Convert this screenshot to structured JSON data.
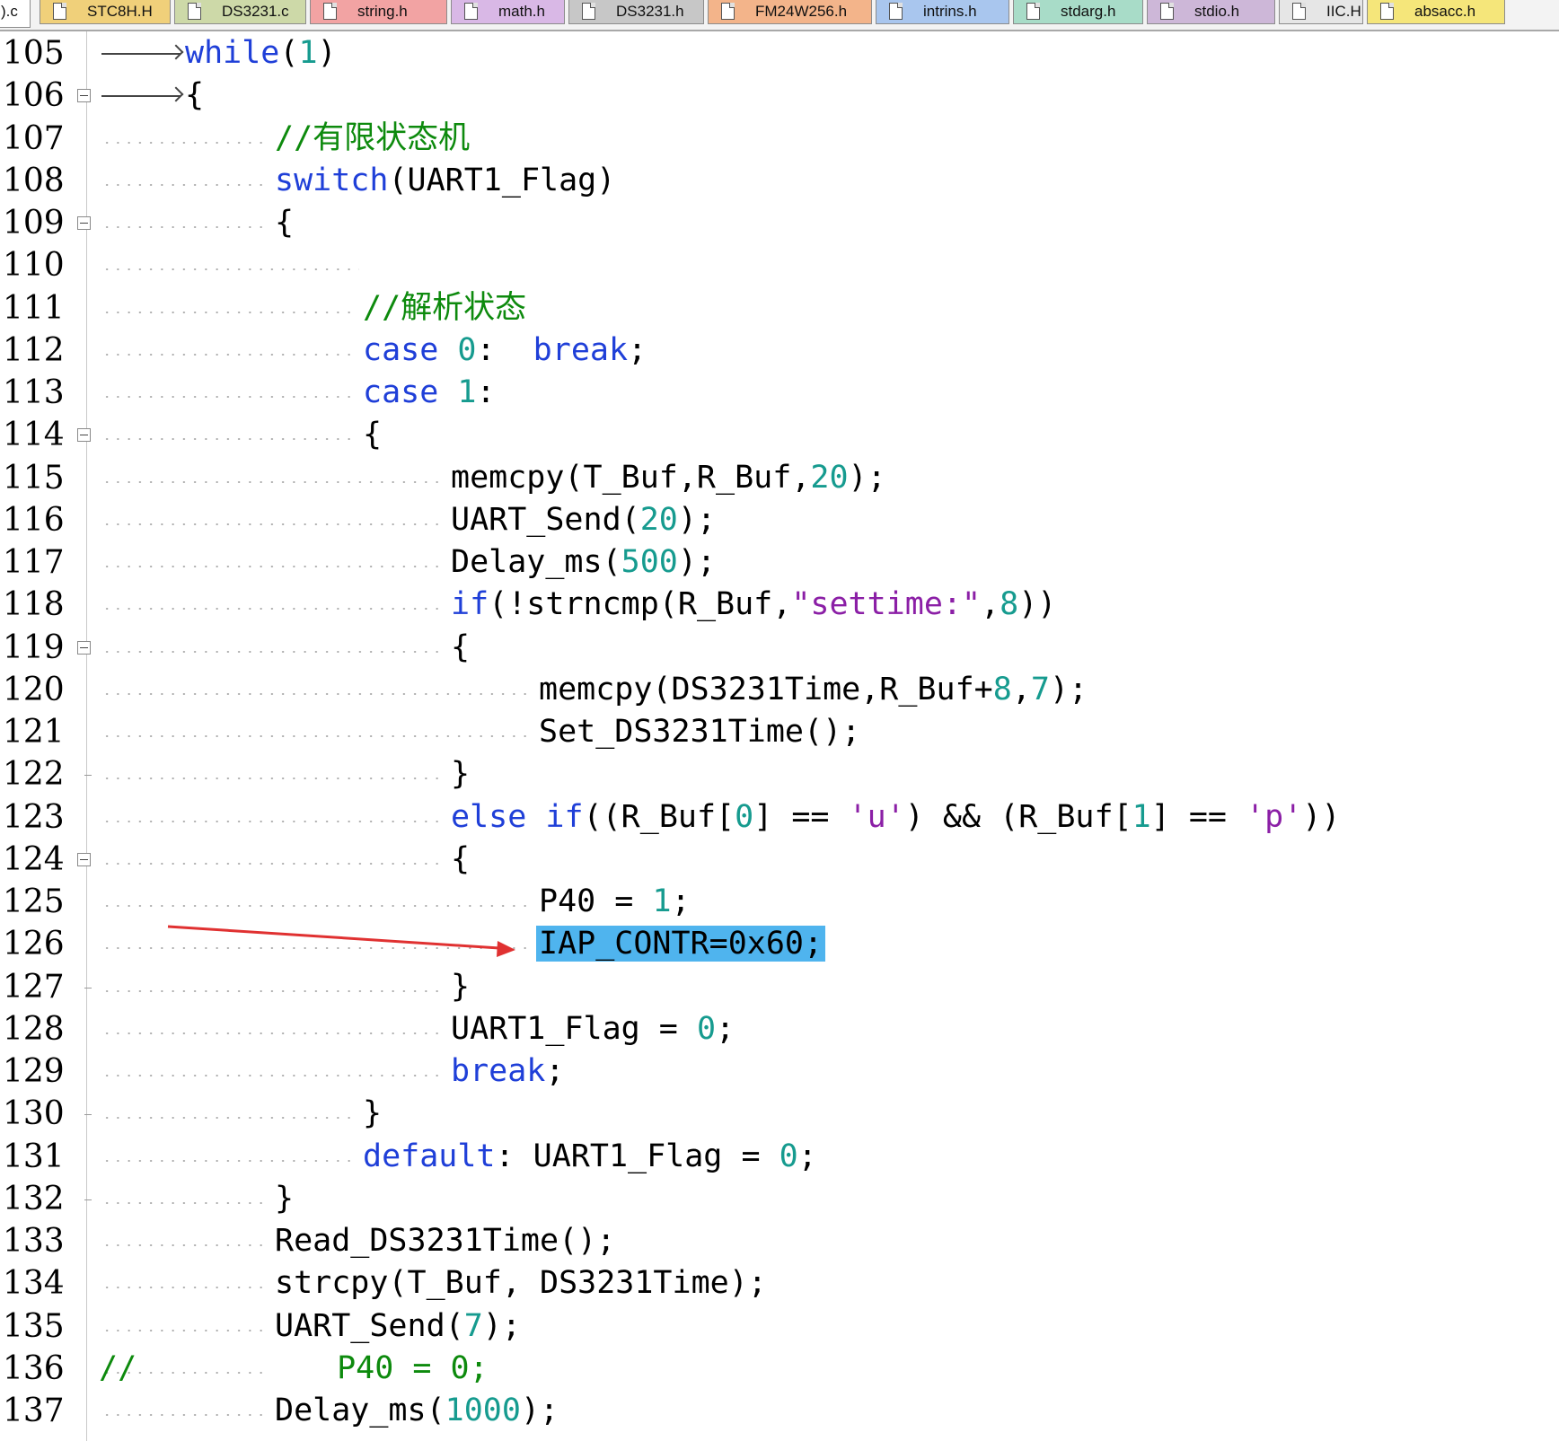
{
  "tabs": [
    {
      "label": ").c",
      "color": "#e8e8e8",
      "active": true
    },
    {
      "label": "STC8H.H",
      "color": "#f0d07a"
    },
    {
      "label": "DS3231.c",
      "color": "#cdd9a8"
    },
    {
      "label": "string.h",
      "color": "#f2a3a3"
    },
    {
      "label": "math.h",
      "color": "#d9b8e6"
    },
    {
      "label": "DS3231.h",
      "color": "#c7c7c7"
    },
    {
      "label": "FM24W256.h",
      "color": "#f3b48a"
    },
    {
      "label": "intrins.h",
      "color": "#a9c6ee"
    },
    {
      "label": "stdarg.h",
      "color": "#a8dcc8"
    },
    {
      "label": "stdio.h",
      "color": "#cdb7d8"
    },
    {
      "label": "IIC.H",
      "color": "#e6e6e6"
    },
    {
      "label": "absacc.h",
      "color": "#f5e67a"
    }
  ],
  "editor": {
    "annotation": "red-arrow pointing at highlighted line 126",
    "lines": [
      {
        "n": "105",
        "indent": 0,
        "tabArrow": true,
        "tokens": [
          [
            "kw",
            "while"
          ],
          [
            "p",
            "("
          ],
          [
            "num",
            "1"
          ],
          [
            "p",
            ")"
          ]
        ]
      },
      {
        "n": "106",
        "indent": 0,
        "tabArrow": true,
        "fold": "open",
        "tokens": [
          [
            "p",
            "{"
          ]
        ]
      },
      {
        "n": "107",
        "indent": 1,
        "tokens": [
          [
            "cmt",
            "//有限状态机"
          ]
        ]
      },
      {
        "n": "108",
        "indent": 1,
        "tokens": [
          [
            "kw",
            "switch"
          ],
          [
            "p",
            "(UART1_Flag)"
          ]
        ]
      },
      {
        "n": "109",
        "indent": 1,
        "fold": "open",
        "tokens": [
          [
            "p",
            "{"
          ]
        ]
      },
      {
        "n": "110",
        "indent": 1,
        "tokens": []
      },
      {
        "n": "111",
        "indent": 2,
        "tokens": [
          [
            "cmt",
            "//解析状态"
          ]
        ]
      },
      {
        "n": "112",
        "indent": 2,
        "tokens": [
          [
            "kw",
            "case"
          ],
          [
            "p",
            " "
          ],
          [
            "num",
            "0"
          ],
          [
            "p",
            ":  "
          ],
          [
            "kw",
            "break"
          ],
          [
            "p",
            ";"
          ]
        ]
      },
      {
        "n": "113",
        "indent": 2,
        "tokens": [
          [
            "kw",
            "case"
          ],
          [
            "p",
            " "
          ],
          [
            "num",
            "1"
          ],
          [
            "p",
            ":"
          ]
        ]
      },
      {
        "n": "114",
        "indent": 2,
        "fold": "open",
        "tokens": [
          [
            "p",
            "{"
          ]
        ]
      },
      {
        "n": "115",
        "indent": 3,
        "tokens": [
          [
            "p",
            "memcpy(T_Buf,R_Buf,"
          ],
          [
            "num",
            "20"
          ],
          [
            "p",
            ");"
          ]
        ]
      },
      {
        "n": "116",
        "indent": 3,
        "tokens": [
          [
            "p",
            "UART_Send("
          ],
          [
            "num",
            "20"
          ],
          [
            "p",
            ");"
          ]
        ]
      },
      {
        "n": "117",
        "indent": 3,
        "tokens": [
          [
            "p",
            "Delay_ms("
          ],
          [
            "num",
            "500"
          ],
          [
            "p",
            ");"
          ]
        ]
      },
      {
        "n": "118",
        "indent": 3,
        "tokens": [
          [
            "kw",
            "if"
          ],
          [
            "p",
            "(!strncmp(R_Buf,"
          ],
          [
            "str",
            "\"settime:\""
          ],
          [
            "p",
            ","
          ],
          [
            "num",
            "8"
          ],
          [
            "p",
            "))"
          ]
        ]
      },
      {
        "n": "119",
        "indent": 3,
        "fold": "open",
        "tokens": [
          [
            "p",
            "{"
          ]
        ]
      },
      {
        "n": "120",
        "indent": 4,
        "tokens": [
          [
            "p",
            "memcpy(DS3231Time,R_Buf+"
          ],
          [
            "num",
            "8"
          ],
          [
            "p",
            ","
          ],
          [
            "num",
            "7"
          ],
          [
            "p",
            ");"
          ]
        ]
      },
      {
        "n": "121",
        "indent": 4,
        "tokens": [
          [
            "p",
            "Set_DS3231Time();"
          ]
        ]
      },
      {
        "n": "122",
        "indent": 3,
        "foldEnd": true,
        "tokens": [
          [
            "p",
            "}"
          ]
        ]
      },
      {
        "n": "123",
        "indent": 3,
        "tokens": [
          [
            "kw",
            "else"
          ],
          [
            "p",
            " "
          ],
          [
            "kw",
            "if"
          ],
          [
            "p",
            "((R_Buf["
          ],
          [
            "num",
            "0"
          ],
          [
            "p",
            "] == "
          ],
          [
            "str",
            "'u'"
          ],
          [
            "p",
            ") && (R_Buf["
          ],
          [
            "num",
            "1"
          ],
          [
            "p",
            "] == "
          ],
          [
            "str",
            "'p'"
          ],
          [
            "p",
            "))"
          ]
        ]
      },
      {
        "n": "124",
        "indent": 3,
        "fold": "open",
        "tokens": [
          [
            "p",
            "{"
          ]
        ]
      },
      {
        "n": "125",
        "indent": 4,
        "tokens": [
          [
            "p",
            "P40 = "
          ],
          [
            "num",
            "1"
          ],
          [
            "p",
            ";"
          ]
        ]
      },
      {
        "n": "126",
        "indent": 4,
        "selected": true,
        "tokens": [
          [
            "sel",
            "IAP_CONTR=0x60;"
          ]
        ]
      },
      {
        "n": "127",
        "indent": 3,
        "foldEnd": true,
        "tokens": [
          [
            "p",
            "}"
          ]
        ]
      },
      {
        "n": "128",
        "indent": 3,
        "tokens": [
          [
            "p",
            "UART1_Flag = "
          ],
          [
            "num",
            "0"
          ],
          [
            "p",
            ";"
          ]
        ]
      },
      {
        "n": "129",
        "indent": 3,
        "tokens": [
          [
            "kw",
            "break"
          ],
          [
            "p",
            ";"
          ]
        ]
      },
      {
        "n": "130",
        "indent": 2,
        "foldEnd": true,
        "tokens": [
          [
            "p",
            "}"
          ]
        ]
      },
      {
        "n": "131",
        "indent": 2,
        "tokens": [
          [
            "kw",
            "default"
          ],
          [
            "p",
            ": UART1_Flag = "
          ],
          [
            "num",
            "0"
          ],
          [
            "p",
            ";"
          ]
        ]
      },
      {
        "n": "132",
        "indent": 1,
        "foldEnd": true,
        "tokens": [
          [
            "p",
            "}"
          ]
        ]
      },
      {
        "n": "133",
        "indent": 1,
        "tokens": [
          [
            "p",
            "Read_DS3231Time();"
          ]
        ]
      },
      {
        "n": "134",
        "indent": 1,
        "tokens": [
          [
            "p",
            "strcpy(T_Buf, DS3231Time);"
          ]
        ]
      },
      {
        "n": "135",
        "indent": 1,
        "tokens": [
          [
            "p",
            "UART_Send("
          ],
          [
            "num",
            "7"
          ],
          [
            "p",
            ");"
          ]
        ]
      },
      {
        "n": "136",
        "indent": 1,
        "commentPrefix": "//",
        "tokens": [
          [
            "cmt",
            " P40 = 0;"
          ]
        ]
      },
      {
        "n": "137",
        "indent": 1,
        "tokens": [
          [
            "p",
            "Delay_ms("
          ],
          [
            "num",
            "1000"
          ],
          [
            "p",
            ");"
          ]
        ]
      }
    ]
  }
}
